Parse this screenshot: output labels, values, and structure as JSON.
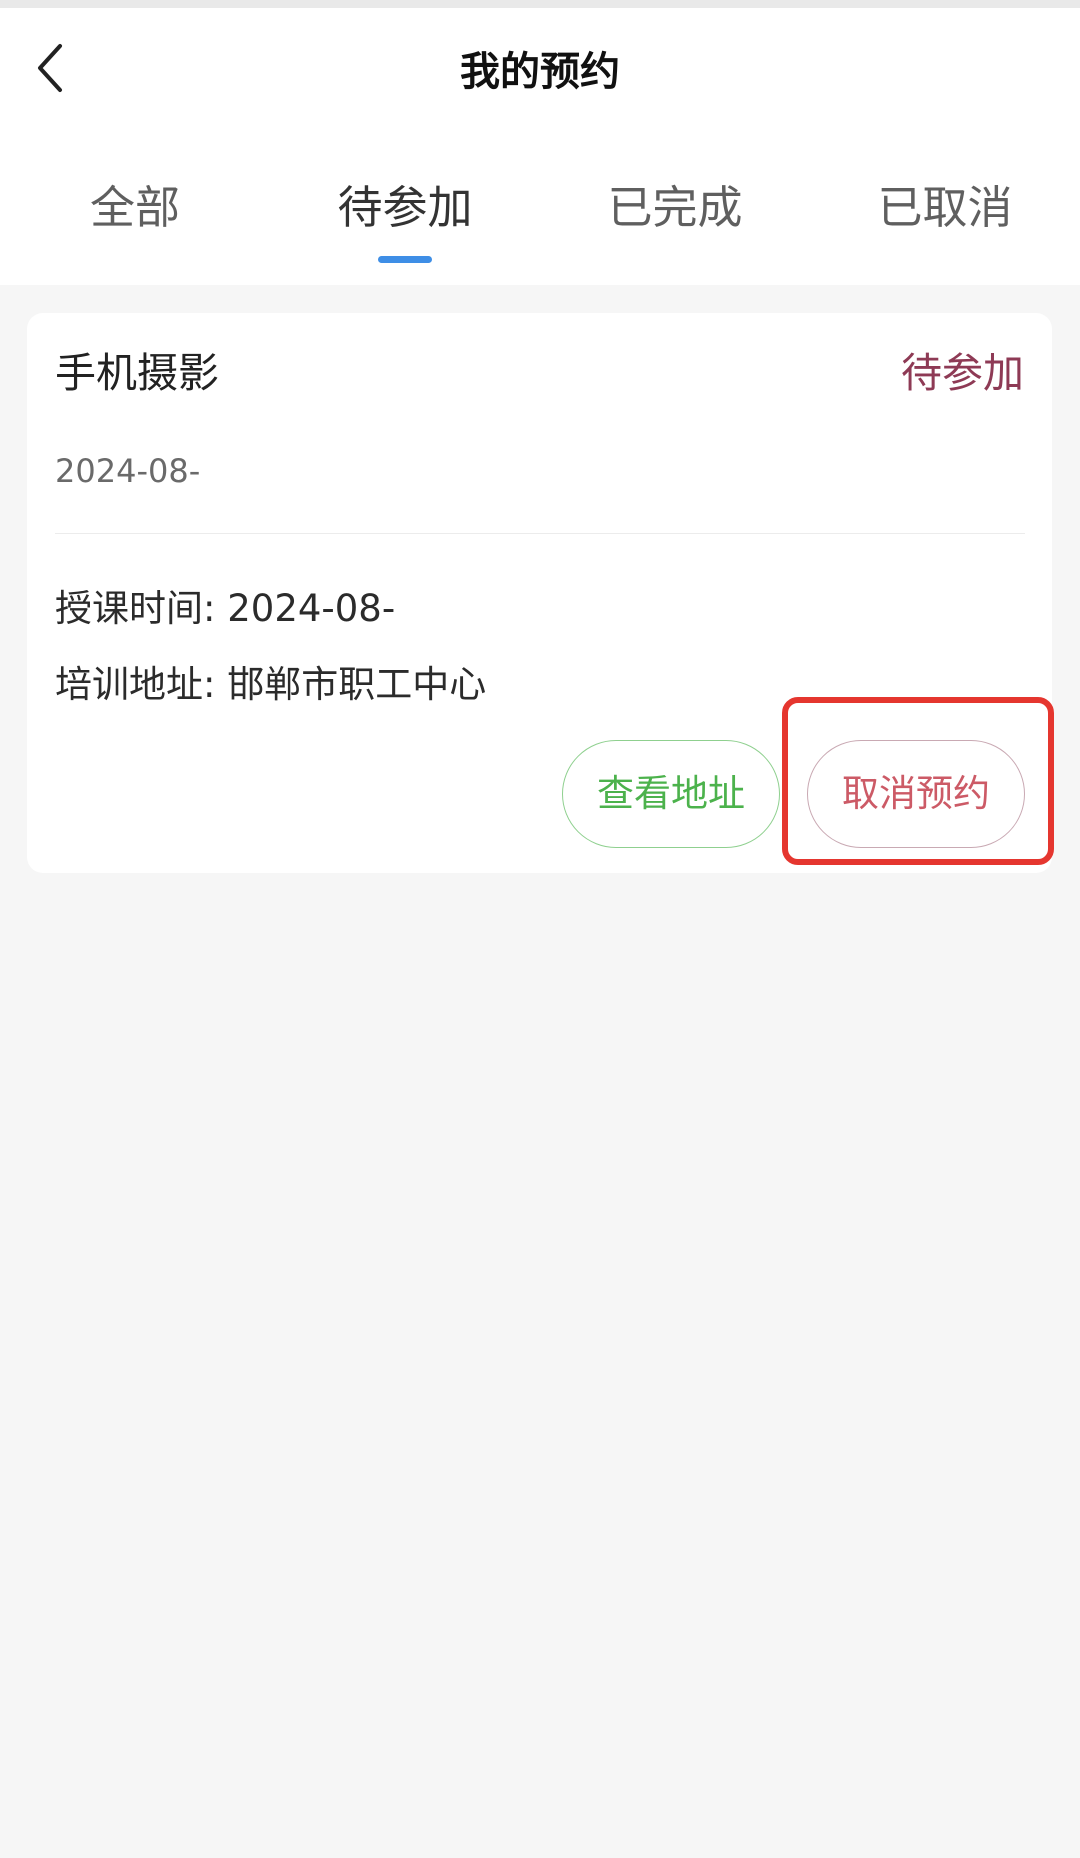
{
  "header": {
    "title": "我的预约",
    "back_icon": "chevron-left-icon"
  },
  "tabs": [
    {
      "label": "全部",
      "active": false
    },
    {
      "label": "待参加",
      "active": true
    },
    {
      "label": "已完成",
      "active": false
    },
    {
      "label": "已取消",
      "active": false
    }
  ],
  "colors": {
    "active_tab_indicator": "#3e8ee6",
    "status_text": "#8e3a55",
    "address_button": "#4cb24c",
    "cancel_button": "#cc5a66",
    "highlight": "#e5362f"
  },
  "card": {
    "course_title": "手机摄影",
    "status": "待参加",
    "date": "2024-08-",
    "class_time_label": "授课时间: ",
    "class_time_value": "2024-08-",
    "address_label": "培训地址: ",
    "address_value": "邯郸市职工中心",
    "buttons": {
      "view_address": "查看地址",
      "cancel_booking": "取消预约"
    }
  }
}
